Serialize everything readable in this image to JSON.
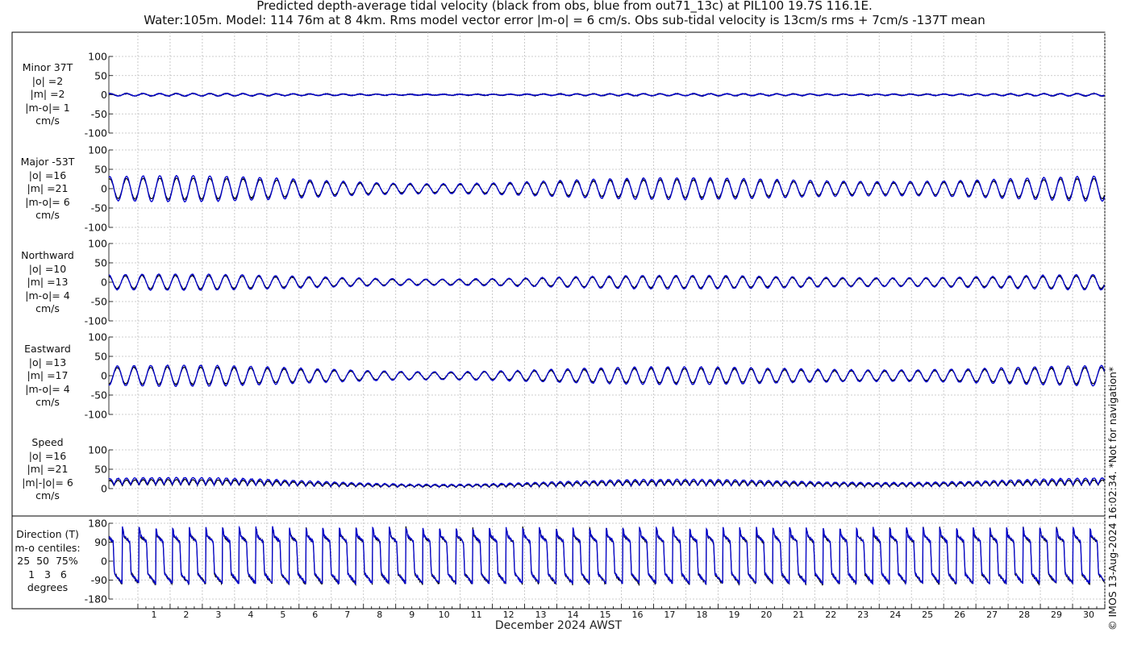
{
  "window": {
    "width": 1400,
    "height": 800
  },
  "title_line1": "Predicted depth-average tidal velocity (black from obs, blue from out71_13c) at PIL100 19.7S 116.1E.",
  "title_line2": "Water:105m. Model: 114 76m at 8 4km. Rms model vector error |m-o| = 6 cm/s. Obs sub-tidal velocity is 13cm/s rms + 7cm/s -137T mean",
  "credit": "© IMOS 13-Aug-2024 16:02:34. *Not for navigation*",
  "colors": {
    "obs": "#000000",
    "model": "#0000cc",
    "grid": "#bdbdbd"
  },
  "chart_data": {
    "type": "line",
    "xlabel": "December 2024 AWST",
    "x_ticks": [
      "1",
      "2",
      "3",
      "4",
      "5",
      "6",
      "7",
      "8",
      "9",
      "10",
      "11",
      "12",
      "13",
      "14",
      "15",
      "16",
      "17",
      "18",
      "19",
      "20",
      "21",
      "22",
      "23",
      "24",
      "25",
      "26",
      "27",
      "28",
      "29",
      "30"
    ],
    "x_range_days": [
      0.1,
      31.0
    ],
    "series_names": {
      "obs": "obs",
      "model": "out71_13c"
    },
    "panels": [
      {
        "key": "minor",
        "label": [
          "Minor 37T",
          "|o| =2",
          "|m| =2",
          "|m-o|= 1",
          "cm/s"
        ],
        "ylim": [
          -100,
          100
        ],
        "yticks": [
          "100",
          "50",
          "0",
          "-50",
          "-100"
        ],
        "obs_amplitude": 2,
        "model_amplitude": 2
      },
      {
        "key": "major",
        "label": [
          "Major -53T",
          "|o| =16",
          "|m| =21",
          "|m-o|= 6",
          "cm/s"
        ],
        "ylim": [
          -100,
          100
        ],
        "yticks": [
          "100",
          "50",
          "0",
          "-50",
          "-100"
        ],
        "obs_amplitude": 16,
        "model_amplitude": 21
      },
      {
        "key": "north",
        "label": [
          "Northward",
          "|o| =10",
          "|m| =13",
          "|m-o|= 4",
          "cm/s"
        ],
        "ylim": [
          -100,
          100
        ],
        "yticks": [
          "100",
          "50",
          "0",
          "-50",
          "-100"
        ],
        "obs_amplitude": 10,
        "model_amplitude": 13
      },
      {
        "key": "east",
        "label": [
          "Eastward",
          "|o| =13",
          "|m| =17",
          "|m-o|= 4",
          "cm/s"
        ],
        "ylim": [
          -100,
          100
        ],
        "yticks": [
          "100",
          "50",
          "0",
          "-50",
          "-100"
        ],
        "obs_amplitude": 13,
        "model_amplitude": 17
      },
      {
        "key": "speed",
        "label": [
          "Speed",
          "|o| =16",
          "|m| =21",
          "|m|-|o|= 6",
          "cm/s"
        ],
        "ylim": [
          0,
          100
        ],
        "yticks": [
          "100",
          "50",
          "0"
        ],
        "obs_amplitude": 16,
        "model_amplitude": 21
      },
      {
        "key": "direction",
        "label": [
          "Direction (T)",
          "m-o centiles:",
          "25  50  75%",
          "1   3   6",
          "degrees"
        ],
        "ylim": [
          -180,
          180
        ],
        "yticks": [
          "180",
          "90",
          "0",
          "-90",
          "-180"
        ]
      }
    ]
  }
}
